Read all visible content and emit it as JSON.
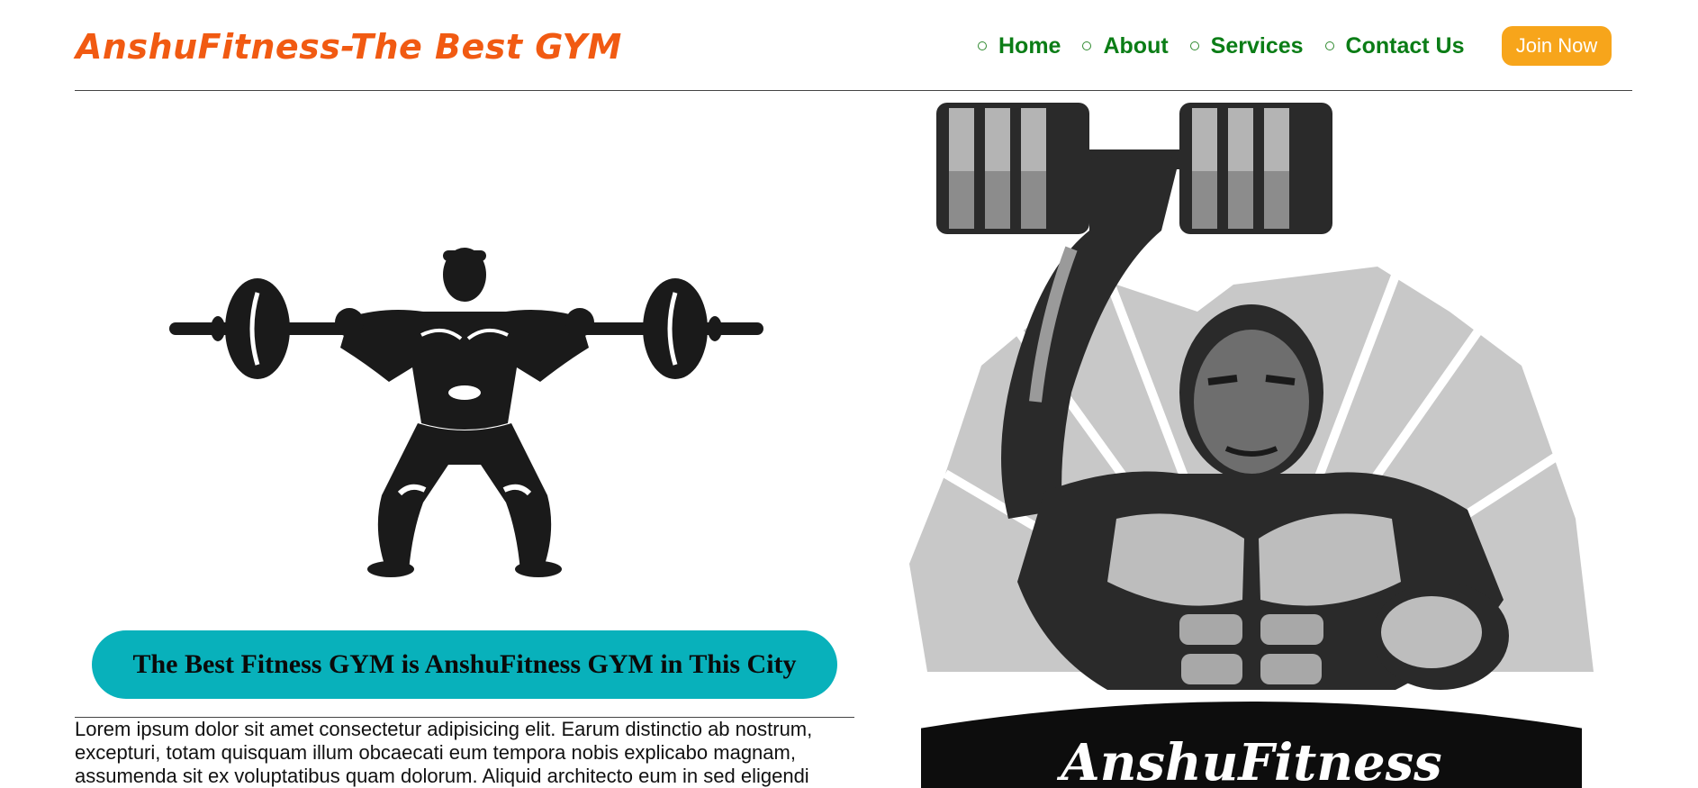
{
  "header": {
    "brand": "AnshuFitness-The Best GYM",
    "nav": [
      {
        "label": "Home"
      },
      {
        "label": "About"
      },
      {
        "label": "Services"
      },
      {
        "label": "Contact Us"
      }
    ],
    "join_label": "Join Now"
  },
  "hero": {
    "tagline": "The Best Fitness GYM is AnshuFitness GYM in This City",
    "body": "Lorem ipsum dolor sit amet consectetur adipisicing elit. Earum distinctio ab nostrum, excepturi, totam quisquam illum obcaecati eum tempora nobis explicabo magnam, assumenda sit ex voluptatibus quam dolorum. Aliquid architecto eum in sed eligendi",
    "logo_text": "AnshuFitness"
  },
  "colors": {
    "brand": "#f15a12",
    "nav": "#0b7d16",
    "join_button": "#f7a51b",
    "tagline_bg": "#08b1bb"
  },
  "icons": {
    "left_illustration": "weightlifter-barbell-icon",
    "right_illustration": "bodybuilder-dumbbell-logo"
  }
}
